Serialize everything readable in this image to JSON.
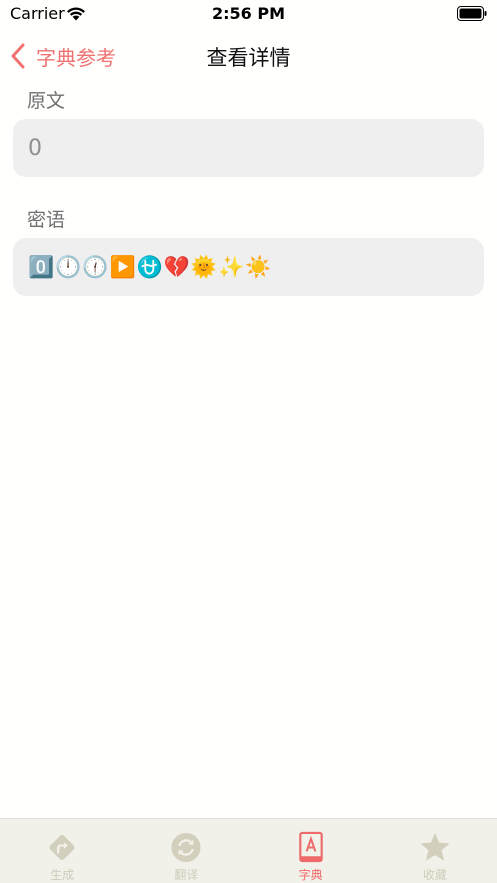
{
  "status_bar": {
    "carrier": "Carrier",
    "time": "2:56 PM"
  },
  "nav": {
    "back_label": "字典参考",
    "title": "查看详情"
  },
  "original": {
    "label": "原文",
    "value": "0"
  },
  "cipher": {
    "label": "密语",
    "value": "0️⃣🕛🕧▶️⛎💔🌞✨☀️"
  },
  "tabs": [
    {
      "label": "生成",
      "icon": "direction-sign-icon",
      "active": false
    },
    {
      "label": "翻译",
      "icon": "refresh-icon",
      "active": false
    },
    {
      "label": "字典",
      "icon": "dictionary-book-icon",
      "active": true
    },
    {
      "label": "收藏",
      "icon": "star-icon",
      "active": false
    }
  ],
  "colors": {
    "accent": "#ef7272",
    "tab_inactive": "#cfccba",
    "field_bg": "#efefef",
    "tab_bar_bg": "#f2f1e9"
  }
}
